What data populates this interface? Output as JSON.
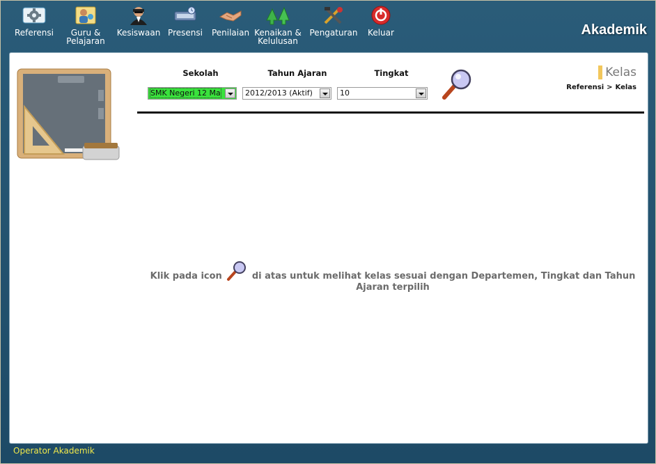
{
  "app": {
    "title": "Akademik"
  },
  "menu": [
    {
      "id": "referensi",
      "label": "Referensi",
      "icon": "gear-settings-icon"
    },
    {
      "id": "guru",
      "label": "Guru &\nPelajaran",
      "icon": "teacher-icon"
    },
    {
      "id": "kesiswaan",
      "label": "Kesiswaan",
      "icon": "student-icon"
    },
    {
      "id": "presensi",
      "label": "Presensi",
      "icon": "attendance-icon"
    },
    {
      "id": "penilaian",
      "label": "Penilaian",
      "icon": "handshake-icon"
    },
    {
      "id": "kenaikan",
      "label": "Kenaikan &\nKelulusan",
      "icon": "arrows-up-icon"
    },
    {
      "id": "pengaturan",
      "label": "Pengaturan",
      "icon": "tools-icon"
    },
    {
      "id": "keluar",
      "label": "Keluar",
      "icon": "power-icon"
    }
  ],
  "filters": {
    "sekolah": {
      "label": "Sekolah",
      "value": "SMK Negeri 12 Ma"
    },
    "tahun": {
      "label": "Tahun Ajaran",
      "value": "2012/2013 (Aktif)"
    },
    "tingkat": {
      "label": "Tingkat",
      "value": "10"
    }
  },
  "page": {
    "title": "Kelas",
    "breadcrumb": {
      "parent": "Referensi",
      "separator": ">",
      "current": "Kelas"
    }
  },
  "hint": {
    "before": "Klik pada icon",
    "after": "di atas untuk melihat kelas sesuai dengan Departemen, Tingkat dan Tahun Ajaran terpilih"
  },
  "footer": {
    "user": "Operator Akademik"
  },
  "colors": {
    "header_bg": "#1f4f6b",
    "selected_green": "#39e23c",
    "footer_text": "#f0e84a",
    "title_accent": "#f2c75c"
  }
}
